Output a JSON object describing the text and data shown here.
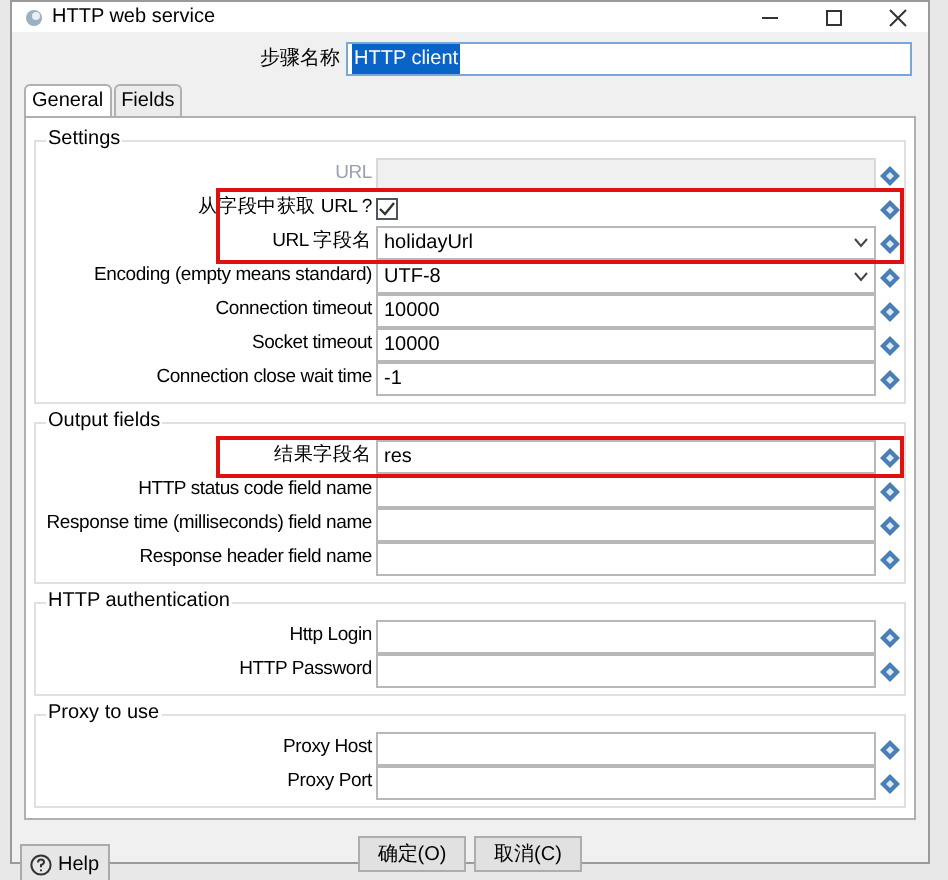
{
  "window": {
    "title": "HTTP web service"
  },
  "step_name": {
    "label": "步骤名称",
    "value": "HTTP client"
  },
  "tabs": [
    {
      "label": "General",
      "selected": true
    },
    {
      "label": "Fields",
      "selected": false
    }
  ],
  "groups": [
    {
      "title": "Settings",
      "rows": [
        {
          "kind": "text",
          "label": "URL",
          "value": "",
          "disabled": true,
          "highlighted": false
        },
        {
          "kind": "checkbox",
          "label": "从字段中获取 URL ?",
          "checked": true,
          "disabled": false,
          "highlighted": true
        },
        {
          "kind": "combo",
          "label": "URL 字段名",
          "value": "holidayUrl",
          "disabled": false,
          "highlighted": true
        },
        {
          "kind": "combo",
          "label": "Encoding (empty means standard)",
          "value": "UTF-8",
          "disabled": false,
          "highlighted": false
        },
        {
          "kind": "text",
          "label": "Connection timeout",
          "value": "10000",
          "disabled": false,
          "highlighted": false
        },
        {
          "kind": "text",
          "label": "Socket timeout",
          "value": "10000",
          "disabled": false,
          "highlighted": false
        },
        {
          "kind": "text",
          "label": "Connection close wait time",
          "value": "-1",
          "disabled": false,
          "highlighted": false
        }
      ]
    },
    {
      "title": "Output fields",
      "rows": [
        {
          "kind": "text",
          "label": "结果字段名",
          "value": "res",
          "disabled": false,
          "highlighted": true
        },
        {
          "kind": "text",
          "label": "HTTP status code field name",
          "value": "",
          "disabled": false,
          "highlighted": false
        },
        {
          "kind": "text",
          "label": "Response time (milliseconds) field name",
          "value": "",
          "disabled": false,
          "highlighted": false
        },
        {
          "kind": "text",
          "label": "Response header field name",
          "value": "",
          "disabled": false,
          "highlighted": false
        }
      ]
    },
    {
      "title": "HTTP authentication",
      "rows": [
        {
          "kind": "text",
          "label": "Http Login",
          "value": "",
          "disabled": false,
          "highlighted": false
        },
        {
          "kind": "text",
          "label": "HTTP Password",
          "value": "",
          "disabled": false,
          "highlighted": false
        }
      ]
    },
    {
      "title": "Proxy to use",
      "rows": [
        {
          "kind": "text",
          "label": "Proxy Host",
          "value": "",
          "disabled": false,
          "highlighted": false
        },
        {
          "kind": "text",
          "label": "Proxy Port",
          "value": "",
          "disabled": false,
          "highlighted": false
        }
      ]
    }
  ],
  "help_button": {
    "label": "Help"
  },
  "buttons": [
    "确定(O)",
    "取消(C)"
  ]
}
